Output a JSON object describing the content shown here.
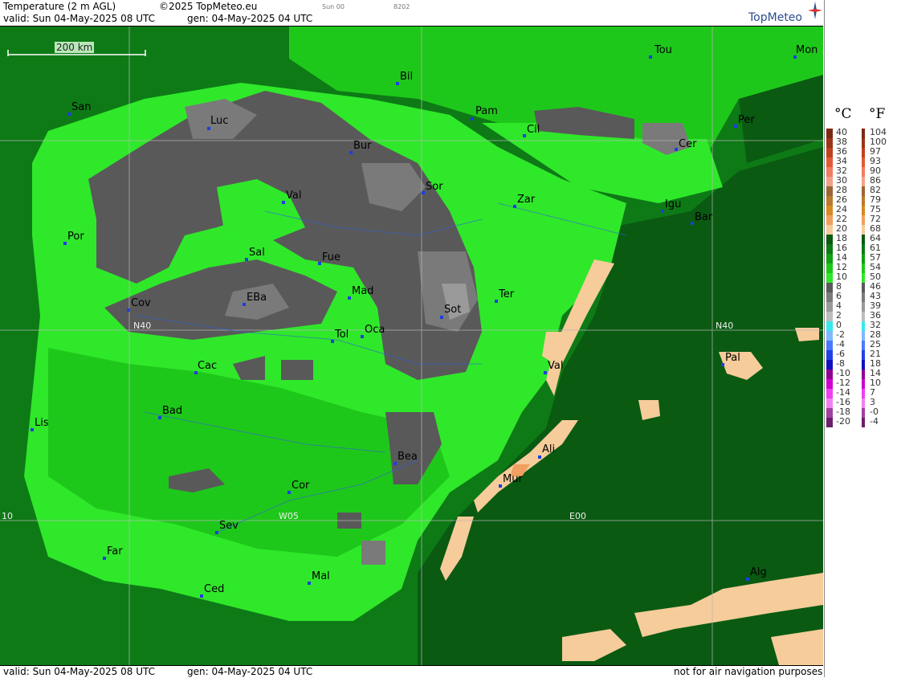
{
  "header": {
    "product": "Temperature (2 m AGL)",
    "copyright": "©2025 TopMeteo.eu",
    "run": "Sun 00",
    "code": "8202",
    "valid": "valid:  Sun  04-May-2025  08 UTC",
    "gen": "gen: 04-May-2025 04 UTC",
    "logo": "TopMeteo"
  },
  "footer": {
    "valid": "valid:  Sun  04-May-2025  08 UTC",
    "gen": "gen: 04-May-2025 04 UTC",
    "notice": "not for air navigation purposes"
  },
  "scale_bar": {
    "label": "200 km"
  },
  "grid_labels": [
    "N40",
    "N40",
    "W05",
    "E00",
    "10"
  ],
  "cities": [
    "Tou",
    "Mon",
    "Bil",
    "San",
    "Pam",
    "Luc",
    "Cil",
    "Per",
    "Bur",
    "Cer",
    "Sor",
    "Val",
    "Zar",
    "Igu",
    "Bar",
    "Por",
    "Sal",
    "Fue",
    "Mad",
    "Cov",
    "EBa",
    "Sot",
    "Ter",
    "Tol",
    "Oca",
    "Pal",
    "Cac",
    "Val",
    "Bad",
    "Lis",
    "Bea",
    "Ali",
    "Mur",
    "Cor",
    "Sev",
    "Far",
    "Alg",
    "Mal",
    "Ced"
  ],
  "legend": {
    "celsius_unit": "°C",
    "fahrenheit_unit": "°F",
    "celsius": [
      "40",
      "38",
      "36",
      "34",
      "32",
      "30",
      "28",
      "26",
      "24",
      "22",
      "20",
      "18",
      "16",
      "14",
      "12",
      "10",
      "8",
      "6",
      "4",
      "2",
      "0",
      "-2",
      "-4",
      "-6",
      "-8",
      "-10",
      "-12",
      "-14",
      "-16",
      "-18",
      "-20"
    ],
    "fahrenheit": [
      "104",
      "100",
      "97",
      "93",
      "90",
      "86",
      "82",
      "79",
      "75",
      "72",
      "68",
      "64",
      "61",
      "57",
      "54",
      "50",
      "46",
      "43",
      "39",
      "36",
      "32",
      "28",
      "25",
      "21",
      "18",
      "14",
      "10",
      "7",
      "3",
      "-0",
      "-4"
    ],
    "colors": [
      "#7a2a14",
      "#9b3418",
      "#c0411e",
      "#e25a36",
      "#f27b64",
      "#f3a08a",
      "#996633",
      "#b87a2e",
      "#d68a22",
      "#f0a060",
      "#f6cc9a",
      "#0a5a12",
      "#0e7a16",
      "#10a012",
      "#1ec81a",
      "#2fe82a",
      "#595959",
      "#7a7a7a",
      "#9a9a9a",
      "#bdbdbd",
      "#38e8ee",
      "#7fb8ff",
      "#4a78ff",
      "#2240e8",
      "#1010c0",
      "#900090",
      "#d000d0",
      "#f040f0",
      "#f080f0",
      "#a040a0",
      "#6a206a"
    ]
  }
}
